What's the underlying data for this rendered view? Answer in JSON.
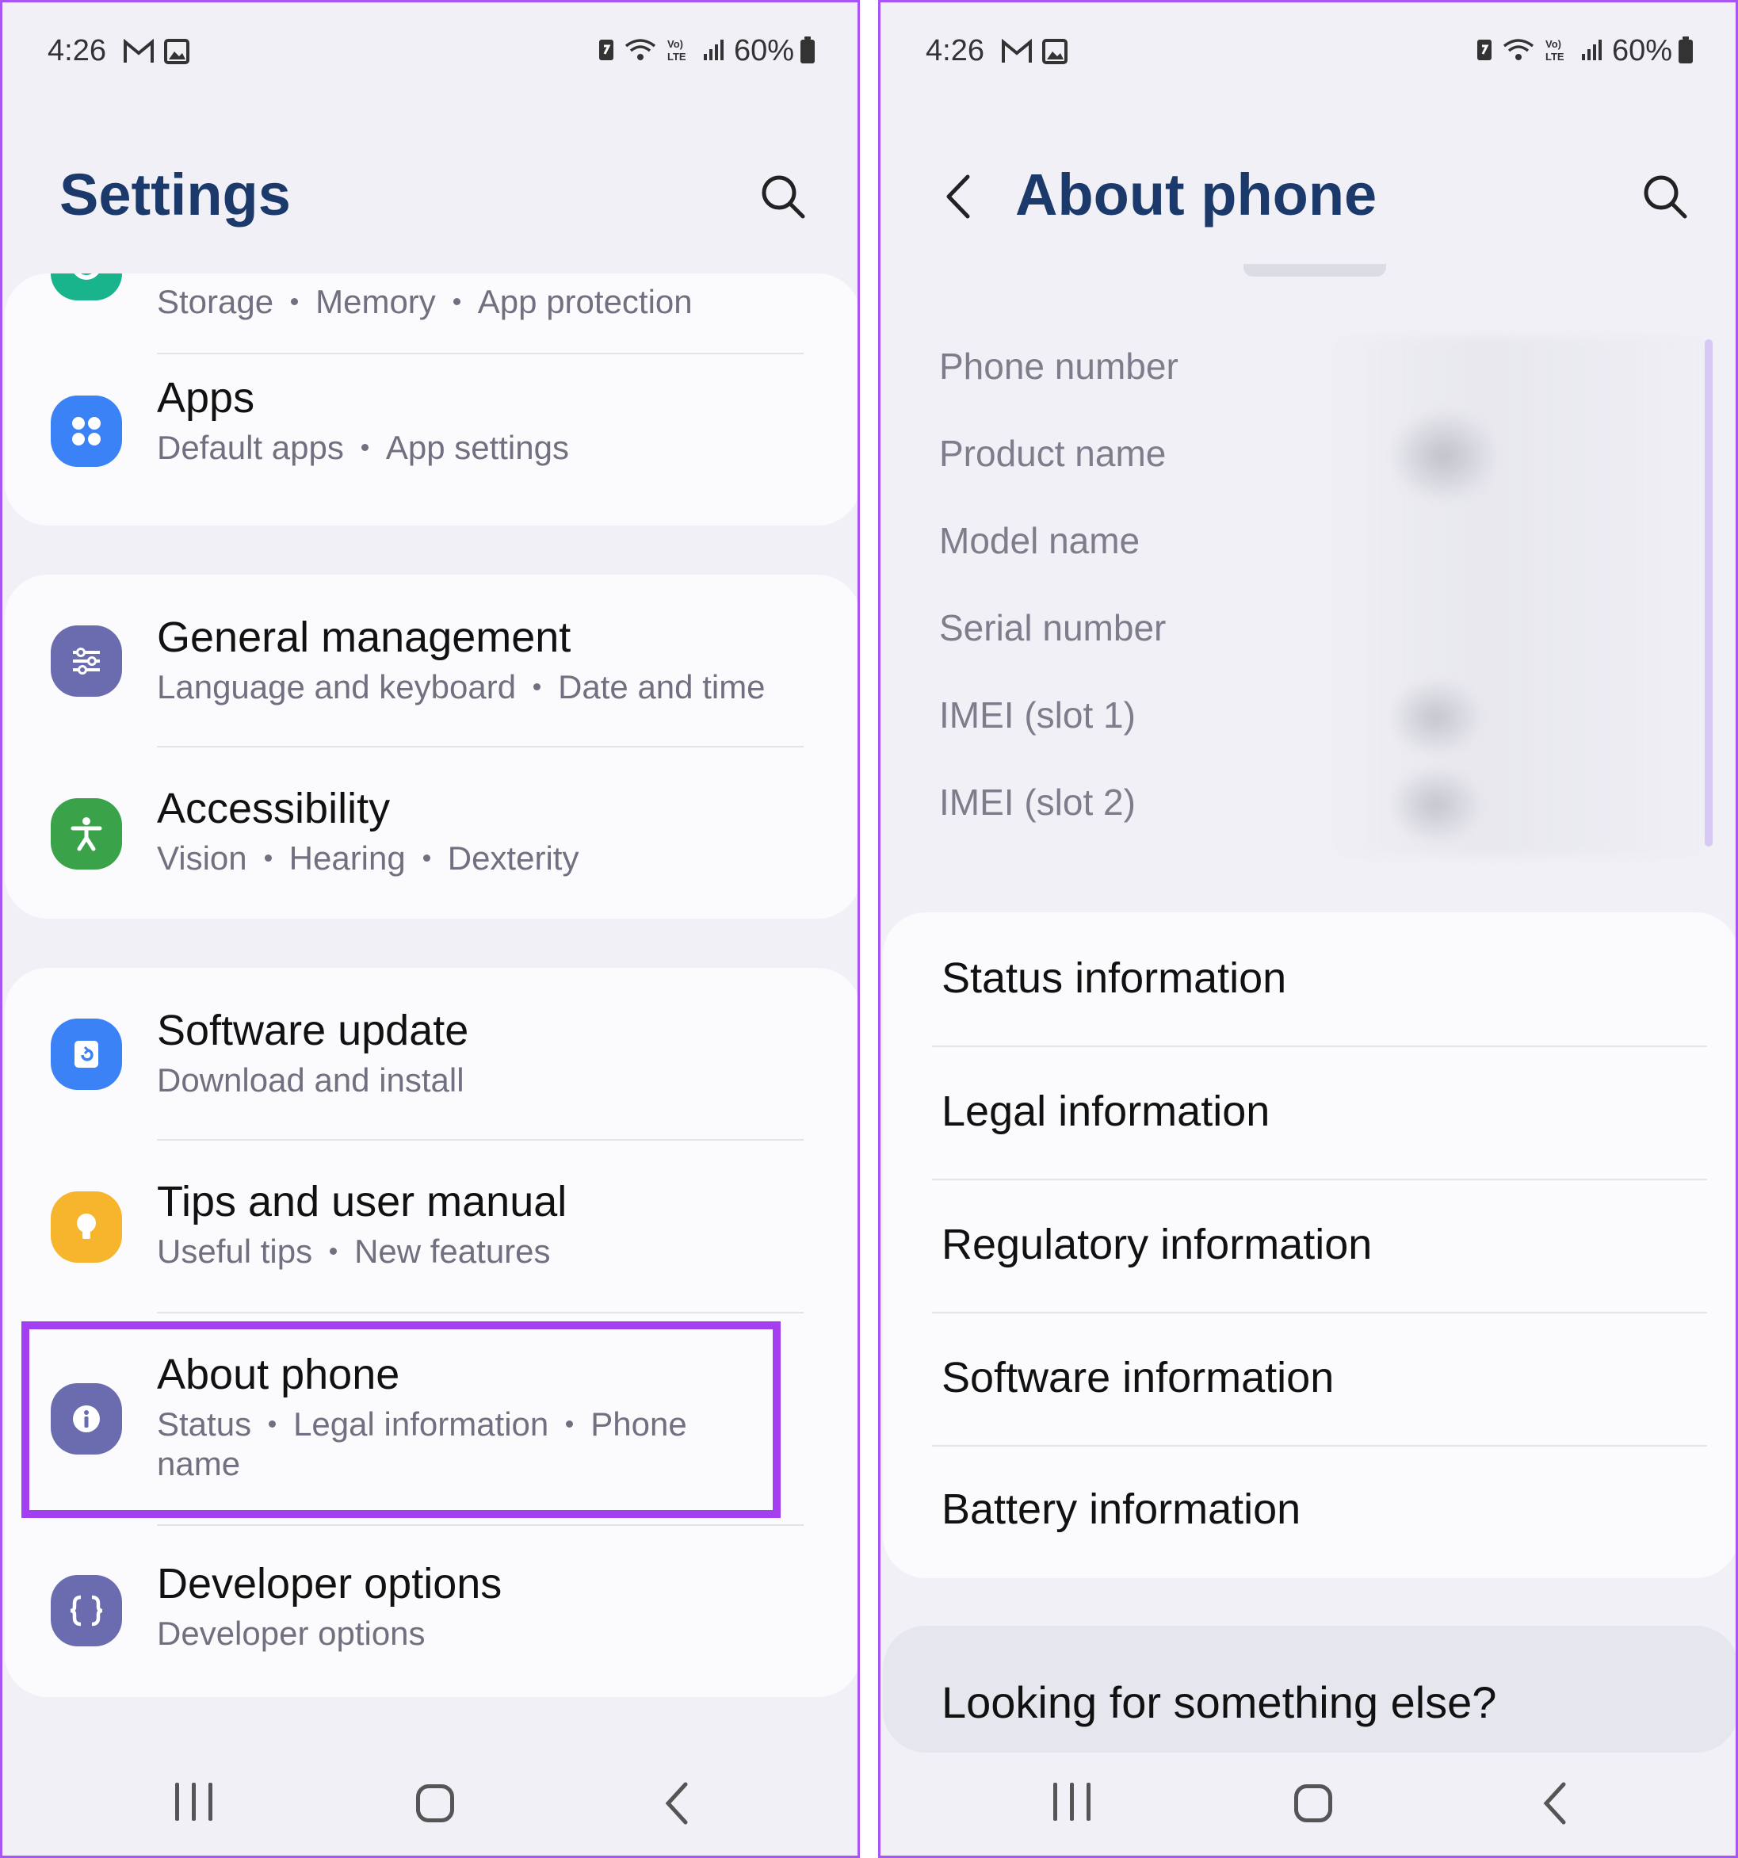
{
  "left": {
    "status_bar": {
      "time": "4:26",
      "battery": "60%"
    },
    "header": {
      "title": "Settings"
    },
    "card1": {
      "top_row_sub": [
        "Storage",
        "Memory",
        "App protection"
      ],
      "apps": {
        "title": "Apps",
        "sub": [
          "Default apps",
          "App settings"
        ]
      }
    },
    "card2": {
      "general": {
        "title": "General management",
        "sub": [
          "Language and keyboard",
          "Date and time"
        ]
      },
      "accessibility": {
        "title": "Accessibility",
        "sub": [
          "Vision",
          "Hearing",
          "Dexterity"
        ]
      }
    },
    "card3": {
      "software_update": {
        "title": "Software update",
        "sub": [
          "Download and install"
        ]
      },
      "tips": {
        "title": "Tips and user manual",
        "sub": [
          "Useful tips",
          "New features"
        ]
      },
      "about": {
        "title": "About phone",
        "sub": [
          "Status",
          "Legal information",
          "Phone"
        ],
        "sub_line2": "name"
      },
      "developer": {
        "title": "Developer options",
        "sub": [
          "Developer options"
        ]
      }
    }
  },
  "right": {
    "status_bar": {
      "time": "4:26",
      "battery": "60%"
    },
    "header": {
      "title": "About phone"
    },
    "info_labels": [
      "Phone number",
      "Product name",
      "Model name",
      "Serial number",
      "IMEI (slot 1)",
      "IMEI (slot 2)"
    ],
    "menu": [
      "Status information",
      "Legal information",
      "Regulatory information",
      "Software information",
      "Battery information"
    ],
    "looking": "Looking for something else?"
  },
  "colors": {
    "title_blue": "#1b3a6b",
    "highlight": "#a33ff0",
    "panel_border": "#a855f7",
    "apps_icon": "#3b82f6",
    "general_icon": "#6b6bb0",
    "accessibility_icon": "#3aa34a",
    "software_icon": "#3b82f6",
    "tips_icon": "#f6b52c",
    "about_icon": "#6b6bb0",
    "developer_icon": "#6b6bb0",
    "device_care_icon": "#19b38c"
  },
  "icons": {
    "search": "search-icon",
    "back": "back-arrow-icon",
    "apps": "apps-grid-icon",
    "general": "sliders-icon",
    "accessibility": "accessibility-person-icon",
    "software_update": "update-icon",
    "tips": "lightbulb-icon",
    "about": "info-icon",
    "developer": "braces-icon"
  }
}
